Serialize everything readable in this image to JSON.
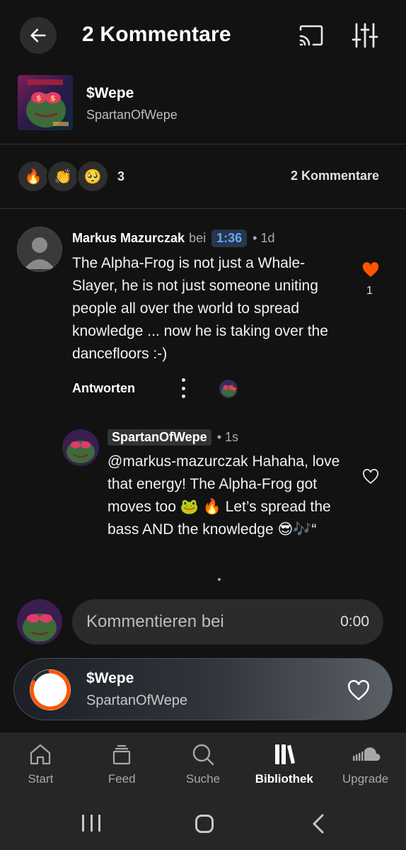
{
  "header": {
    "title": "2 Kommentare",
    "back_icon": "arrow-left-icon",
    "cast_icon": "cast-icon",
    "settings_icon": "equalizer-sliders-icon"
  },
  "track": {
    "title": "$Wepe",
    "artist": "SpartanOfWepe",
    "artwork_icon": "pepe-artwork"
  },
  "reactions": {
    "emojis": [
      "🔥",
      "👏",
      "🥺"
    ],
    "count": "3",
    "comments_label": "2 Kommentare"
  },
  "comment": {
    "user": "Markus Mazurczak",
    "bei": "bei",
    "timestamp": "1:36",
    "ago": "• 1d",
    "body": "The Alpha-Frog is not just a Whale-Slayer, he is not just someone uniting people all over the world to spread knowledge ... now he is taking over the dancefloors :-)",
    "likes": "1",
    "reply_label": "Antworten"
  },
  "reply": {
    "user": "SpartanOfWepe",
    "ago": "• 1s",
    "body": "@markus-mazurczak Hahaha, love that energy! The Alpha-Frog got moves too 🐸 🔥 Let’s spread the bass AND the knowledge 😎🎶“"
  },
  "comment_input": {
    "placeholder": "Kommentieren bei",
    "time": "0:00"
  },
  "mini_player": {
    "title": "$Wepe",
    "artist": "SpartanOfWepe",
    "progress": 0.82
  },
  "bottom_nav": [
    {
      "label": "Start",
      "icon": "home-icon"
    },
    {
      "label": "Feed",
      "icon": "feed-icon"
    },
    {
      "label": "Suche",
      "icon": "search-icon"
    },
    {
      "label": "Bibliothek",
      "icon": "library-icon",
      "active": true
    },
    {
      "label": "Upgrade",
      "icon": "soundcloud-icon"
    }
  ],
  "colors": {
    "accent": "#ff5500",
    "timestamp_bg": "#26364d",
    "timestamp_fg": "#6aa5ff",
    "background": "#121212"
  }
}
